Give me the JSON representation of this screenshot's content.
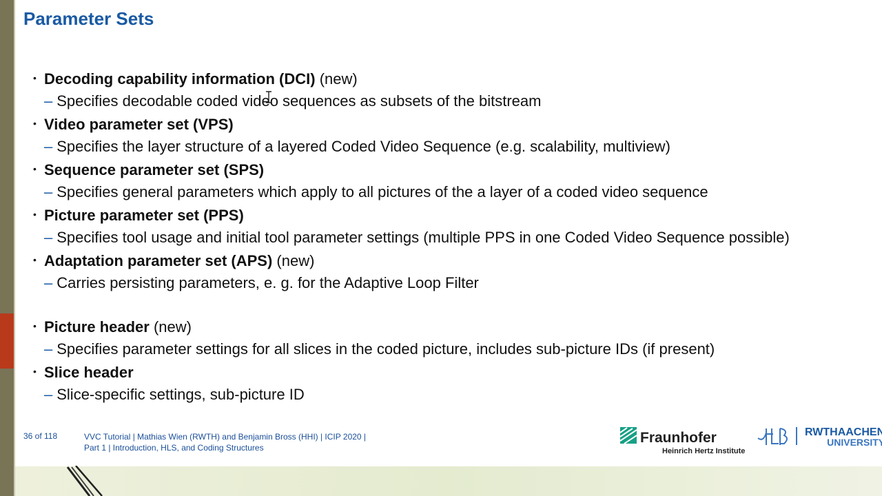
{
  "title": "Parameter Sets",
  "bullets": [
    {
      "head": "Decoding capability information (DCI)",
      "note": "(new)",
      "sub": "Specifies decodable coded video sequences as subsets of the bitstream"
    },
    {
      "head": "Video parameter set (VPS)",
      "note": "",
      "sub": "Specifies the layer structure of a layered Coded Video Sequence (e.g. scalability, multiview)"
    },
    {
      "head": "Sequence parameter set (SPS)",
      "note": "",
      "sub": "Specifies general parameters which apply to all pictures of the a layer of a coded video sequence"
    },
    {
      "head": "Picture parameter set (PPS)",
      "note": "",
      "sub": "Specifies tool usage and initial tool parameter settings (multiple PPS in one Coded Video Sequence possible)"
    },
    {
      "head": "Adaptation parameter set (APS)",
      "note": "(new)",
      "sub": "Carries persisting parameters, e. g. for the Adaptive Loop Filter"
    },
    {
      "head": "Picture header",
      "note": "(new)",
      "sub": "Specifies parameter settings for all slices in the coded picture, includes sub-picture IDs (if present)"
    },
    {
      "head": "Slice header",
      "note": "",
      "sub": "Slice-specific settings, sub-picture ID"
    }
  ],
  "footer": {
    "page": "36 of 118",
    "line1": "VVC Tutorial  |  Mathias Wien (RWTH) and Benjamin Bross (HHI)  |  ICIP 2020  |",
    "line2": "Part 1  |  Introduction, HLS, and Coding Structures"
  },
  "logos": {
    "fraunhofer": "Fraunhofer",
    "fraunhofer_sub": "Heinrich Hertz Institute",
    "rwth_top": "RWTHAACHEN",
    "rwth_bottom": "UNIVERSITY"
  },
  "colors": {
    "title": "#1a5aa3",
    "sidebar": "#7a7456",
    "accent": "#b83a1b",
    "fraunhofer": "#17a085"
  }
}
